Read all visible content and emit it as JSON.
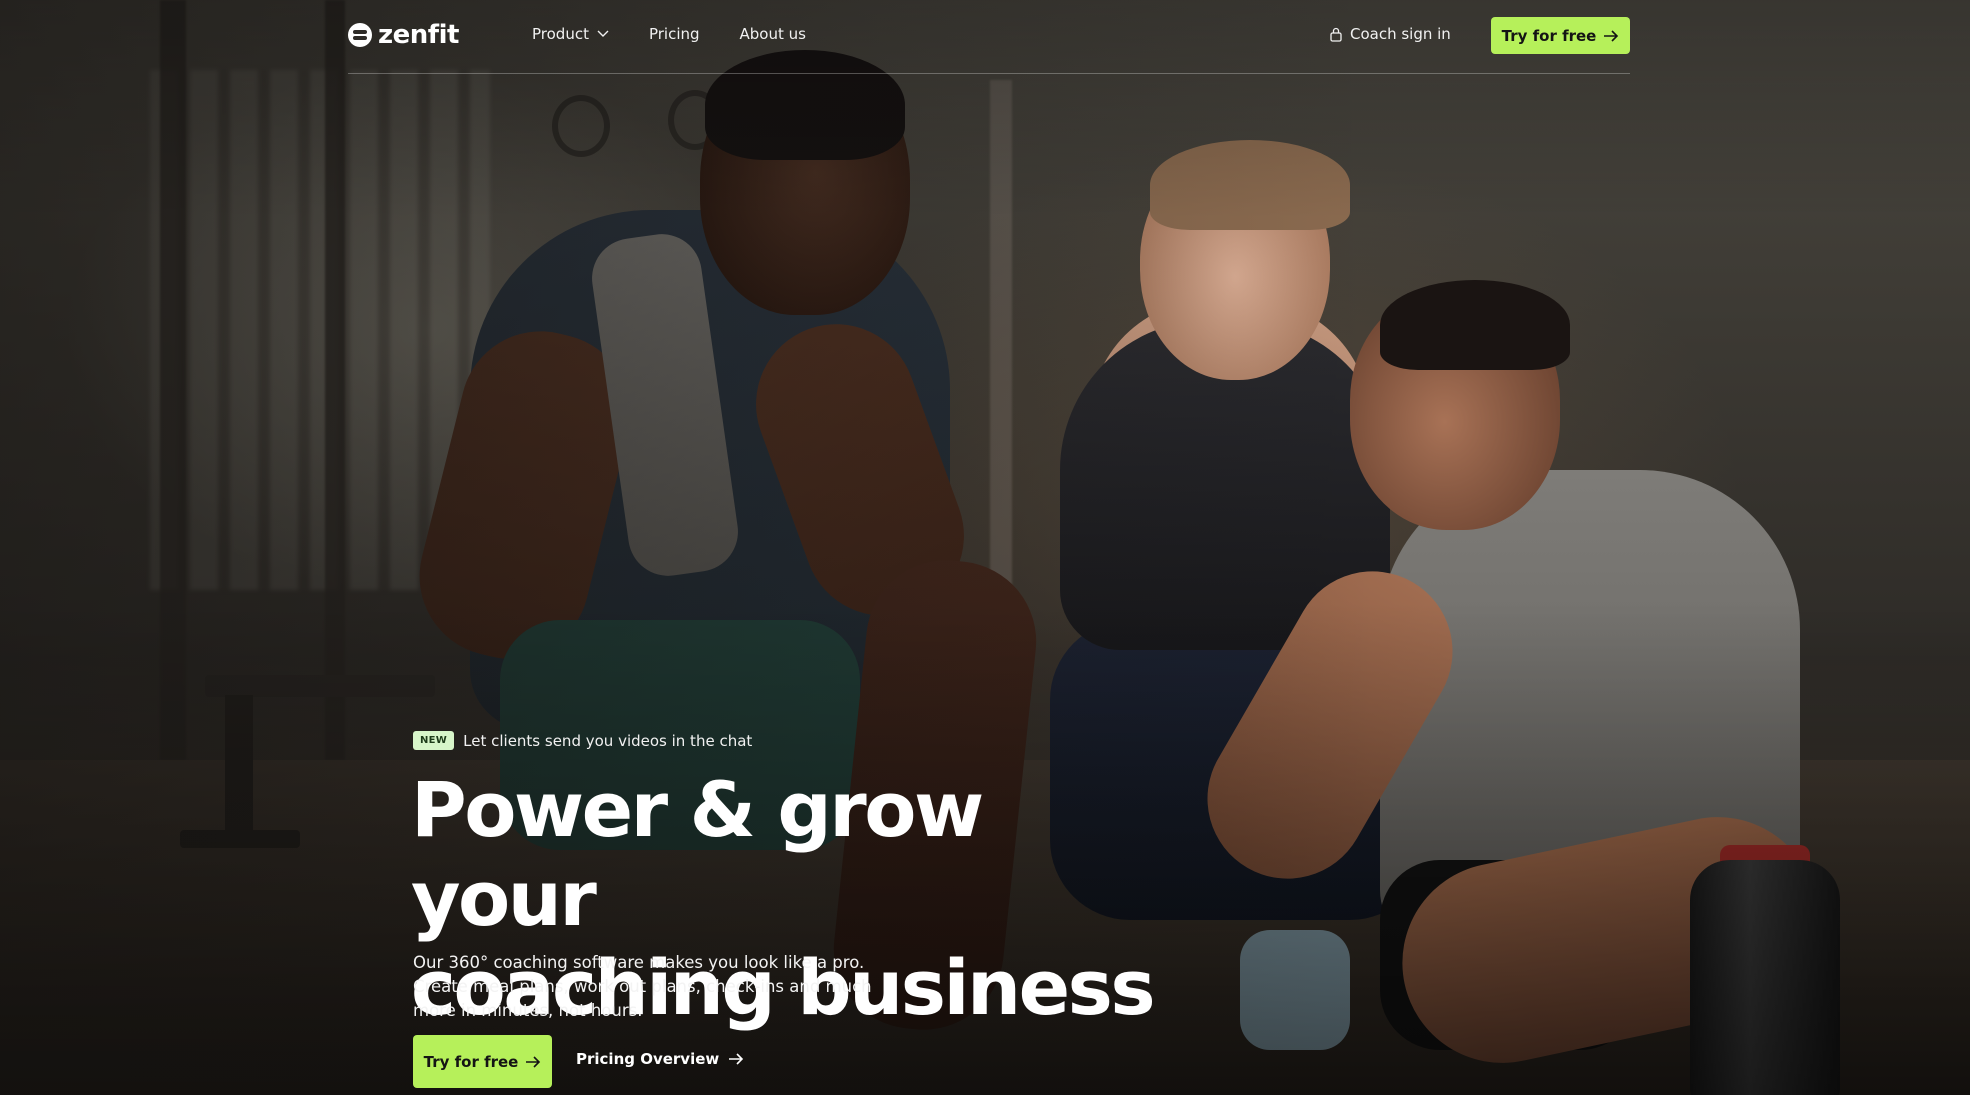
{
  "nav": {
    "logo_text": "zenfit",
    "links": [
      {
        "label": "Product",
        "has_dropdown": true
      },
      {
        "label": "Pricing",
        "has_dropdown": false
      },
      {
        "label": "About us",
        "has_dropdown": false
      }
    ],
    "signin_label": "Coach sign in",
    "cta_label": "Try for free"
  },
  "hero": {
    "badge": "NEW",
    "announcement": "Let clients send you videos in the chat",
    "headline_line1": "Power & grow your",
    "headline_line2": "coaching business",
    "subcopy": "Our 360° coaching software makes you look like a pro. Create meal plans, work out plans, check-ins and much more in minutes, not hours.",
    "primary_cta": "Try for free",
    "secondary_cta": "Pricing Overview"
  },
  "colors": {
    "accent": "#b6f05a",
    "badge_bg": "#d7f5c9"
  },
  "icons": {
    "logo": "zenfit-logo-icon",
    "dropdown": "chevron-down-icon",
    "lock": "lock-icon",
    "arrow": "arrow-right-icon"
  }
}
